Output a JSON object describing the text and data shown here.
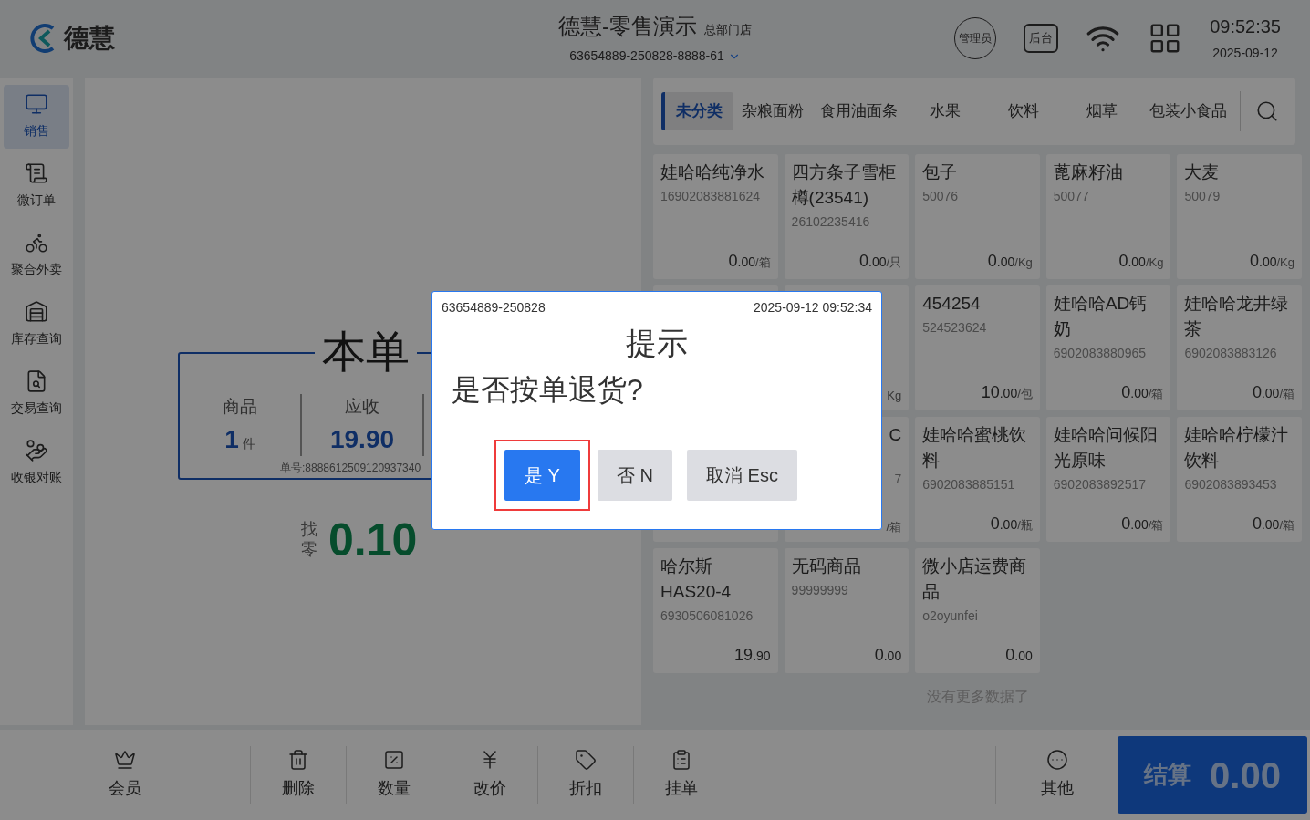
{
  "header": {
    "logo_text": "德慧",
    "title": "德慧-零售演示",
    "store": "总部门店",
    "terminal": "63654889-250828-8888-61",
    "role_badge": "管理员",
    "backend_button": "后台",
    "time": "09:52:35",
    "date": "2025-09-12"
  },
  "sidebar": {
    "items": [
      {
        "label": "销售",
        "selected": true
      },
      {
        "label": "微订单",
        "selected": false
      },
      {
        "label": "聚合外卖",
        "selected": false
      },
      {
        "label": "库存查询",
        "selected": false
      },
      {
        "label": "交易查询",
        "selected": false
      },
      {
        "label": "收银对账",
        "selected": false
      }
    ]
  },
  "order": {
    "title": "本单",
    "stats": [
      {
        "label": "商品",
        "value": "1",
        "unit": "件"
      },
      {
        "label": "应收",
        "value": "19.90"
      }
    ],
    "order_number": "单号:8888612509120937340",
    "change_label": "找零",
    "change": "0.10"
  },
  "categories": [
    {
      "label": "未分类",
      "selected": true
    },
    {
      "label": "杂粮面粉",
      "selected": false
    },
    {
      "label": "食用油面条",
      "selected": false
    },
    {
      "label": "水果",
      "selected": false
    },
    {
      "label": "饮料",
      "selected": false
    },
    {
      "label": "烟草",
      "selected": false
    },
    {
      "label": "包装小食品",
      "selected": false
    }
  ],
  "products": [
    {
      "kind": "full",
      "name": "娃哈哈纯净水",
      "code": "16902083881624",
      "price_int": "0",
      "price_dec": ".00",
      "unit": "/箱"
    },
    {
      "kind": "full",
      "name": "四方条子雪柜樽(23541)",
      "code": "26102235416",
      "price_int": "0",
      "price_dec": ".00",
      "unit": "/只"
    },
    {
      "kind": "full",
      "name": "包子",
      "code": "50076",
      "price_int": "0",
      "price_dec": ".00",
      "unit": "/Kg"
    },
    {
      "kind": "full",
      "name": "蓖麻籽油",
      "code": "50077",
      "price_int": "0",
      "price_dec": ".00",
      "unit": "/Kg"
    },
    {
      "kind": "full",
      "name": "大麦",
      "code": "50079",
      "price_int": "0",
      "price_dec": ".00",
      "unit": "/Kg"
    },
    {
      "kind": "hidden"
    },
    {
      "kind": "partial",
      "unit": "Kg"
    },
    {
      "kind": "full",
      "name": "454254",
      "code": "524523624",
      "price_int": "10",
      "price_dec": ".00",
      "unit": "/包"
    },
    {
      "kind": "full",
      "name": "娃哈哈AD钙奶",
      "code": "6902083880965",
      "price_int": "0",
      "price_dec": ".00",
      "unit": "/箱"
    },
    {
      "kind": "full",
      "name": "娃哈哈龙井绿茶",
      "code": "6902083883126",
      "price_int": "0",
      "price_dec": ".00",
      "unit": "/箱"
    },
    {
      "kind": "hidden"
    },
    {
      "kind": "partial",
      "name": "C",
      "code": "7",
      "unit": "/箱"
    },
    {
      "kind": "full",
      "name": "娃哈哈蜜桃饮料",
      "code": "6902083885151",
      "price_int": "0",
      "price_dec": ".00",
      "unit": "/瓶"
    },
    {
      "kind": "full",
      "name": "娃哈哈问候阳光原味",
      "code": "6902083892517",
      "price_int": "0",
      "price_dec": ".00",
      "unit": "/箱"
    },
    {
      "kind": "full",
      "name": "娃哈哈柠檬汁饮料",
      "code": "6902083893453",
      "price_int": "0",
      "price_dec": ".00",
      "unit": "/箱"
    },
    {
      "kind": "full",
      "name": "哈尔斯 HAS20-4",
      "code": "6930506081026",
      "price_int": "19",
      "price_dec": ".90"
    },
    {
      "kind": "full",
      "name": "无码商品",
      "code": "99999999",
      "price_int": "0",
      "price_dec": ".00"
    },
    {
      "kind": "full",
      "name": "微小店运费商品",
      "code": "o2oyunfei",
      "price_int": "0",
      "price_dec": ".00"
    }
  ],
  "list_end": "没有更多数据了",
  "toolbar": {
    "left": [
      "会员"
    ],
    "middle": [
      "删除",
      "数量",
      "改价",
      "折扣",
      "挂单"
    ],
    "right": [
      "其他"
    ],
    "checkout_label": "结算",
    "checkout_amount": "0.00"
  },
  "dialog": {
    "terminal": "63654889-250828",
    "timestamp": "2025-09-12 09:52:34",
    "title": "提示",
    "message": "是否按单退货?",
    "buttons": [
      {
        "label": "是 Y",
        "kind": "primary",
        "focused": true
      },
      {
        "label": "否 N",
        "kind": "secondary",
        "focused": false
      },
      {
        "label": "取消 Esc",
        "kind": "secondary",
        "focused": false
      }
    ]
  }
}
